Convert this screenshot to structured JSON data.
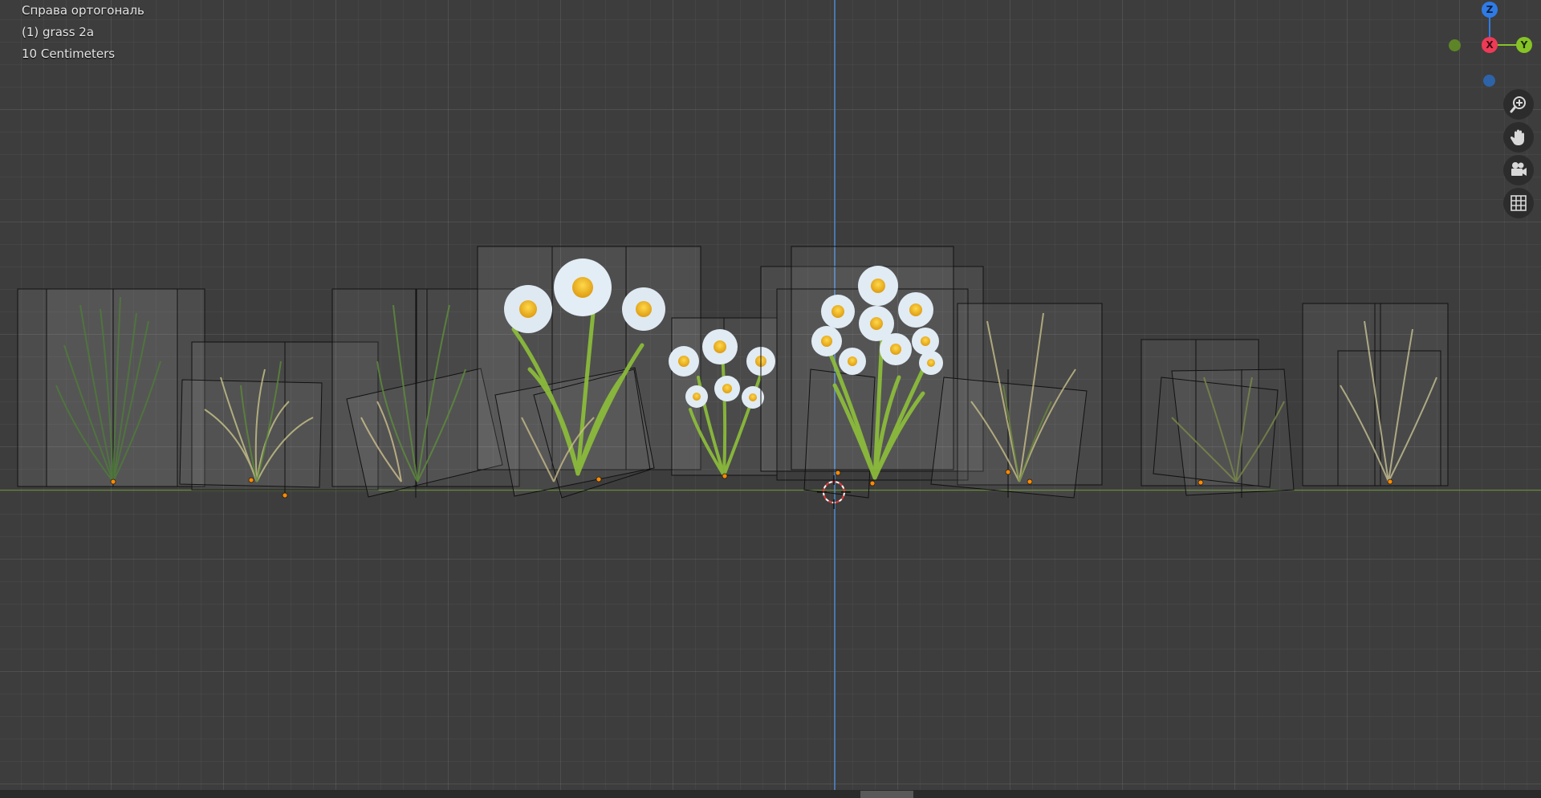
{
  "viewport": {
    "view_name": "Справа ортогональ",
    "active_object": "(1) grass 2a",
    "grid_scale": "10 Centimeters"
  },
  "gizmo": {
    "z_label": "Z",
    "x_label": "X",
    "y_label": "Y",
    "colors": {
      "z": "#2f7be6",
      "x": "#ee3a56",
      "y": "#86c326",
      "neg_y": "#5d8527",
      "neg_z": "#2d63a8"
    }
  },
  "nav_buttons": [
    {
      "name": "zoom-icon"
    },
    {
      "name": "pan-hand-icon"
    },
    {
      "name": "camera-icon"
    },
    {
      "name": "ortho-grid-icon"
    }
  ],
  "colors": {
    "background": "#3d3d3d",
    "z_axis": "#4f86c8",
    "y_axis": "#74a830",
    "origin_dot": "#ff8a00"
  }
}
